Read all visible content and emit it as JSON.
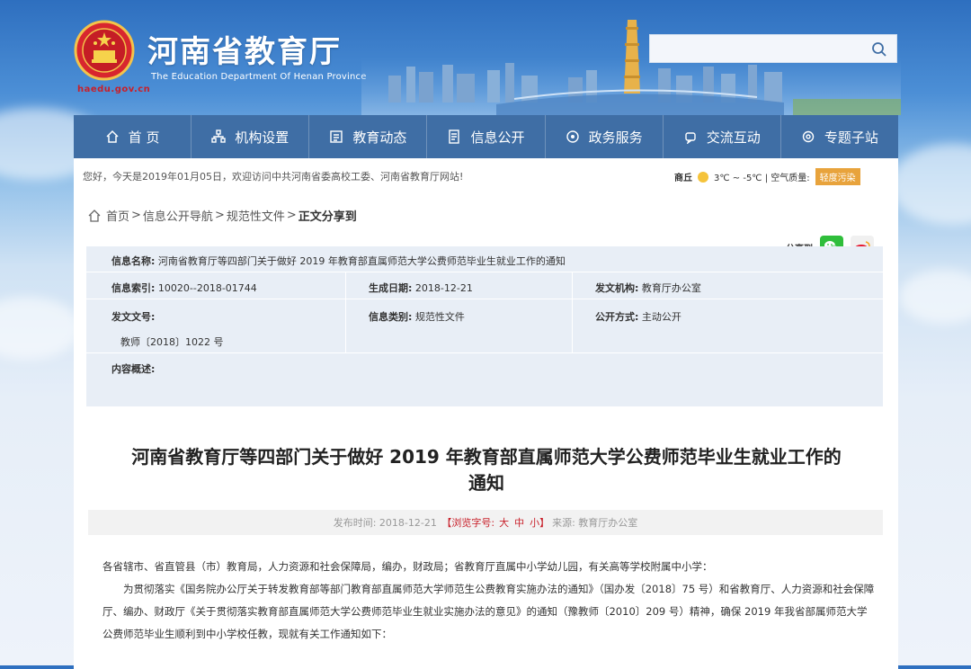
{
  "header": {
    "site_url": "haedu.gov.cn",
    "title": "河南省教育厅",
    "subtitle": "The Education Department Of Henan Province",
    "search_placeholder": ""
  },
  "nav": [
    {
      "label": "首 页",
      "icon": "home-icon"
    },
    {
      "label": "机构设置",
      "icon": "org-icon"
    },
    {
      "label": "教育动态",
      "icon": "news-icon"
    },
    {
      "label": "信息公开",
      "icon": "info-icon"
    },
    {
      "label": "政务服务",
      "icon": "service-icon"
    },
    {
      "label": "交流互动",
      "icon": "chat-icon"
    },
    {
      "label": "专题子站",
      "icon": "topic-icon"
    }
  ],
  "welcome": {
    "text": "您好，今天是2019年01月05日，欢迎访问中共河南省委高校工委、河南省教育厅网站!",
    "city": "商丘",
    "temp": "3℃ ~ -5℃ | 空气质量:",
    "air_quality": "轻度污染"
  },
  "breadcrumb": {
    "home": "首页",
    "sep1": ">",
    "level1": "信息公开导航",
    "sep2": ">",
    "level2": "规范性文件",
    "sep3": ">",
    "current": "正文"
  },
  "share": {
    "label_top": "分享到",
    "label": "分享到"
  },
  "info": {
    "name_label": "信息名称:",
    "name_value": "河南省教育厅等四部门关于做好 2019 年教育部直属师范大学公费师范毕业生就业工作的通知",
    "index_label": "信息索引:",
    "index_value": "10020--2018-01744",
    "date_label": "生成日期:",
    "date_value": "2018-12-21",
    "org_label": "发文机构:",
    "org_value": "教育厅办公室",
    "docno_label": "发文文号:",
    "docno_value": "教师〔2018〕1022 号",
    "category_label": "信息类别:",
    "category_value": "规范性文件",
    "open_label": "公开方式:",
    "open_value": "主动公开",
    "summary_label": "内容概述:"
  },
  "article": {
    "title_line1": "河南省教育厅等四部门关于做好 2019 年教育部直属师范大学公费师范毕业生就业工作的",
    "title_line2": "通知",
    "meta_time_label": "发布时间:",
    "meta_time": "2018-12-21",
    "meta_font_label": "【浏览字号:",
    "meta_font_big": "大",
    "meta_font_mid": "中",
    "meta_font_small": "小】",
    "meta_source_label": "来源:",
    "meta_source": "教育厅办公室",
    "para1": "各省辖市、省直管县（市）教育局，人力资源和社会保障局，编办，财政局；省教育厅直属中小学幼儿园，有关高等学校附属中小学：",
    "para2": "为贯彻落实《国务院办公厅关于转发教育部等部门教育部直属师范大学师范生公费教育实施办法的通知》（国办发〔2018〕75 号）和省教育厅、人力资源和社会保障厅、编办、财政厅《关于贯彻落实教育部直属师范大学公费师范毕业生就业实施办法的意见》的通知（豫教师〔2010〕209 号）精神，确保 2019 年我省部属师范大学公费师范毕业生顺利到中小学校任教，现就有关工作通知如下："
  },
  "colors": {
    "nav_bg": "#3f6ea5",
    "accent_red": "#c8202a",
    "air_badge": "#e8a33c",
    "info_bg": "#e8eef6"
  }
}
